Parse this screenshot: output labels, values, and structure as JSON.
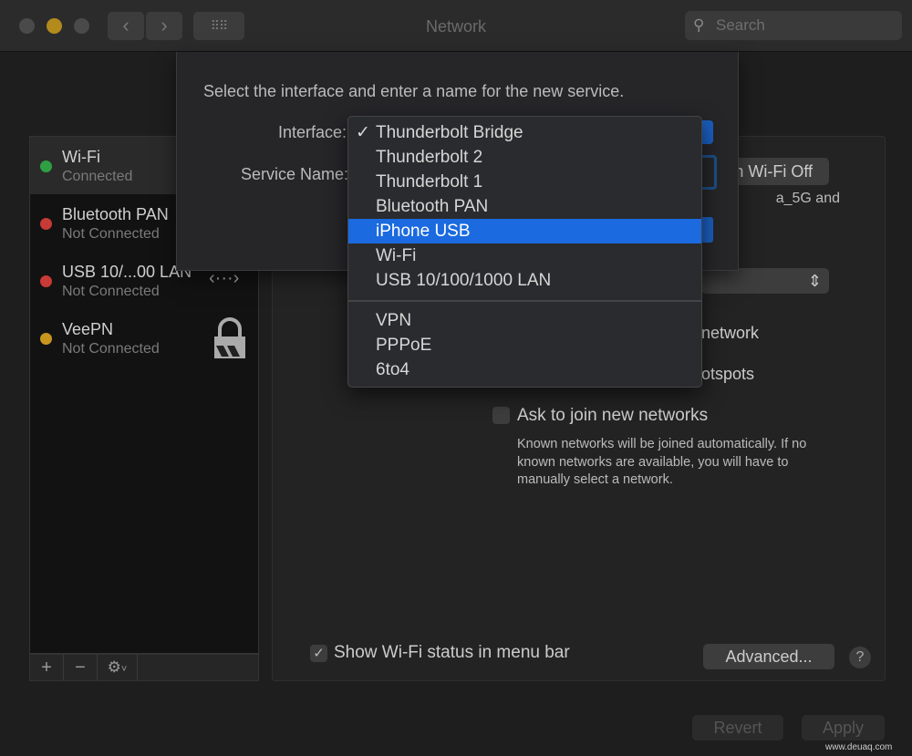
{
  "window": {
    "title": "Network",
    "search_placeholder": "Search",
    "traffic_colors": [
      "#4a4a4a",
      "#b38b1d",
      "#4a4a4a"
    ]
  },
  "services": [
    {
      "name": "Wi-Fi",
      "status": "Connected",
      "color": "#2ea043"
    },
    {
      "name": "Bluetooth PAN",
      "status": "Not Connected",
      "color": "#c83a35"
    },
    {
      "name": "USB 10/...00 LAN",
      "status": "Not Connected",
      "color": "#c83a35",
      "icon": "ethernet-dots-icon"
    },
    {
      "name": "VeePN",
      "status": "Not Connected",
      "color": "#c8951e",
      "icon": "lock-icon"
    }
  ],
  "sidebar_tools": {
    "add": "+",
    "remove": "−",
    "gear": "⚙"
  },
  "sheet": {
    "prompt": "Select the interface and enter a name for the new service.",
    "interface_label": "Interface:",
    "service_name_label": "Service Name:"
  },
  "menu": {
    "items": [
      "Thunderbolt Bridge",
      "Thunderbolt 2",
      "Thunderbolt 1",
      "Bluetooth PAN",
      "iPhone USB",
      "Wi-Fi",
      "USB 10/100/1000 LAN"
    ],
    "items2": [
      "VPN",
      "PPPoE",
      "6to4"
    ],
    "checked": "Thunderbolt Bridge",
    "highlighted": "iPhone USB"
  },
  "panel": {
    "wifi_off": "Turn Wi-Fi Off",
    "partial_text": "a_5G and",
    "network_fragment": "network",
    "hotspots_fragment": "otspots",
    "ask_join": "Ask to join new networks",
    "ask_join_desc": "Known networks will be joined automatically. If no known networks are available, you will have to manually select a network.",
    "show_status": "Show Wi-Fi status in menu bar",
    "advanced": "Advanced...",
    "help": "?"
  },
  "footer": {
    "revert": "Revert",
    "apply": "Apply",
    "watermark": "www.deuaq.com"
  }
}
